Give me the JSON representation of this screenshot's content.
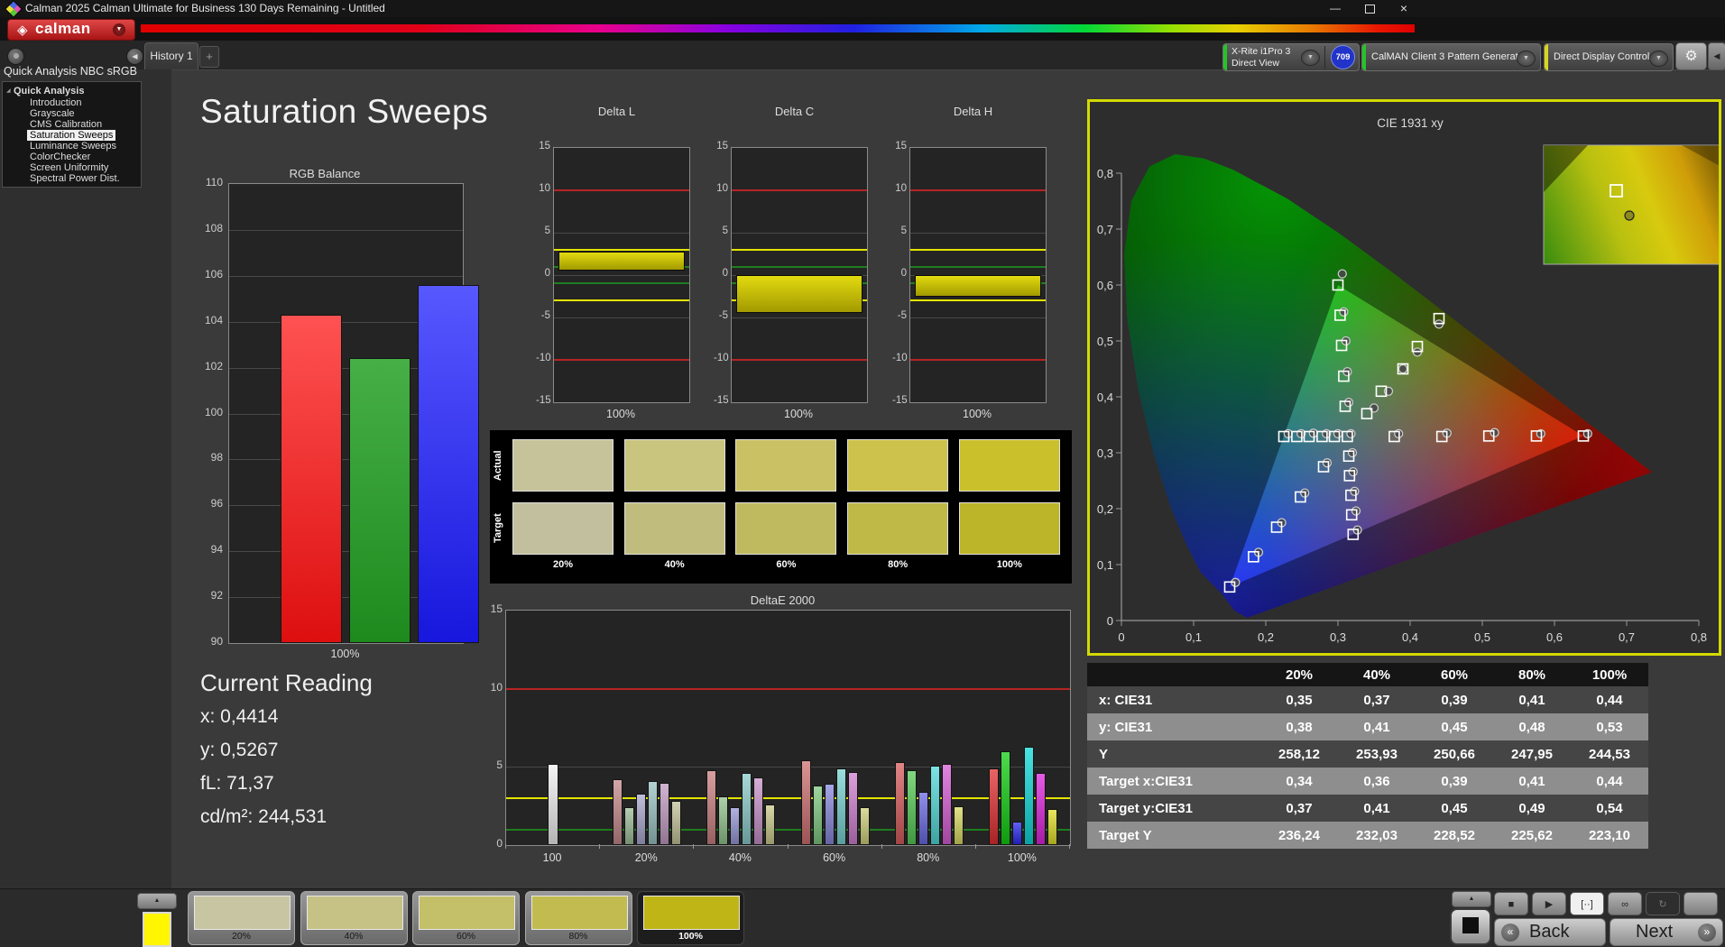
{
  "window": {
    "title": "Calman 2025 Calman Ultimate for Business 130 Days Remaining  - Untitled"
  },
  "icons": {
    "chevron_down": "▼",
    "chevron_left": "◀",
    "gear": "⚙",
    "add_tab": "+",
    "minimize": "—",
    "close": "×",
    "up": "▲",
    "stop": "■",
    "play": "▶",
    "measure": "[··]",
    "loop": "∞",
    "refresh": "↻",
    "back_chev": "«",
    "next_chev": "»",
    "tree_expanded": "◢",
    "logo_diamond": "◈",
    "dot": ""
  },
  "logo": {
    "text": "calman"
  },
  "tabs": {
    "history": "History 1"
  },
  "meters": {
    "meter1_line1": "X-Rite i1Pro 3",
    "meter1_line2": "Direct View",
    "badge": "709",
    "meter1_stripe": "#27c427",
    "meter2": "CalMAN Client 3 Pattern Generator",
    "meter2_stripe": "#27c427",
    "meter3": "Direct Display Control",
    "meter3_stripe": "#d6d621"
  },
  "sidebar": {
    "workflow_title": "Quick Analysis NBC sRGB",
    "root": "Quick Analysis",
    "items": [
      "Introduction",
      "Grayscale",
      "CMS Calibration",
      "Saturation Sweeps",
      "Luminance Sweeps",
      "ColorChecker",
      "Screen Uniformity",
      "Spectral Power Dist."
    ],
    "selected_index": 3
  },
  "page_title": "Saturation Sweeps",
  "current_reading": {
    "heading": "Current Reading",
    "lines": [
      "x: 0,4414",
      "y: 0,5267",
      "fL: 71,37",
      "cd/m²: 244,531"
    ]
  },
  "chart_data": [
    {
      "id": "rgb_balance",
      "type": "bar",
      "title": "RGB Balance",
      "category": "100%",
      "ylim": [
        90,
        110
      ],
      "ytick_step": 2,
      "series": [
        {
          "name": "red",
          "value": 104.3,
          "color_top": "#ff5252",
          "color_bottom": "#dd0f0f"
        },
        {
          "name": "green",
          "value": 102.4,
          "color_top": "#46b046",
          "color_bottom": "#1e8a1e"
        },
        {
          "name": "blue",
          "value": 105.6,
          "color_top": "#5858ff",
          "color_bottom": "#1717dd"
        }
      ]
    },
    {
      "id": "delta_l",
      "type": "bar",
      "title": "Delta L",
      "category": "100%",
      "ylim": [
        -15,
        15
      ],
      "yticks": [
        15,
        10,
        5,
        0,
        -5,
        -10,
        -15
      ],
      "limit_red": 10,
      "limit_yellow": 3,
      "limit_green": 1,
      "bar_from": 0.5,
      "bar_to": 2.8
    },
    {
      "id": "delta_c",
      "type": "bar",
      "title": "Delta C",
      "category": "100%",
      "ylim": [
        -15,
        15
      ],
      "yticks": [
        15,
        10,
        5,
        0,
        -5,
        -10,
        -15
      ],
      "limit_red": 10,
      "limit_yellow": 3,
      "limit_green": 1,
      "bar_from": -4.5,
      "bar_to": 0
    },
    {
      "id": "delta_h",
      "type": "bar",
      "title": "Delta H",
      "category": "100%",
      "ylim": [
        -15,
        15
      ],
      "yticks": [
        15,
        10,
        5,
        0,
        -5,
        -10,
        -15
      ],
      "limit_red": 10,
      "limit_yellow": 3,
      "limit_green": 1,
      "bar_from": -2.5,
      "bar_to": 0
    },
    {
      "id": "deltae2000",
      "type": "grouped_bar",
      "title": "DeltaE 2000",
      "ylim": [
        0,
        15
      ],
      "yticks": [
        0,
        5,
        10,
        15
      ],
      "limit_red": 10,
      "limit_yellow": 3,
      "limit_green": 1,
      "groups": [
        {
          "label": "100",
          "values": [
            5.2
          ],
          "colors": [
            "#f0f0f0"
          ]
        },
        {
          "label": "20%",
          "values": [
            4.2,
            2.4,
            3.3,
            4.1,
            4.0,
            2.8
          ],
          "colors": [
            "#c4898b",
            "#9dbd97",
            "#a8a8cf",
            "#99c2c2",
            "#c29bc2",
            "#c3c39a"
          ]
        },
        {
          "label": "40%",
          "values": [
            4.8,
            3.1,
            2.4,
            4.6,
            4.3,
            2.6
          ],
          "colors": [
            "#c97f7f",
            "#92c28c",
            "#9797d6",
            "#8ccaca",
            "#c791c7",
            "#c9c98c"
          ]
        },
        {
          "label": "60%",
          "values": [
            5.4,
            3.8,
            3.9,
            4.9,
            4.7,
            2.4
          ],
          "colors": [
            "#cf7070",
            "#7fc87f",
            "#8787dd",
            "#78d2d2",
            "#cf80cf",
            "#cfcf7b"
          ]
        },
        {
          "label": "80%",
          "values": [
            5.3,
            4.8,
            3.4,
            5.1,
            5.2,
            2.5
          ],
          "colors": [
            "#d65c5c",
            "#55cc55",
            "#6a6ae5",
            "#52d8d8",
            "#d65cd6",
            "#d8d860"
          ]
        },
        {
          "label": "100%",
          "values": [
            4.9,
            6.0,
            1.5,
            6.3,
            4.6,
            2.3
          ],
          "colors": [
            "#e03030",
            "#12cf12",
            "#2a2af0",
            "#0fd8d8",
            "#de24de",
            "#dede2a"
          ]
        }
      ]
    },
    {
      "id": "cie",
      "type": "scatter",
      "title": "CIE 1931 xy",
      "xlim": [
        0,
        0.8
      ],
      "ylim": [
        0,
        0.8
      ],
      "xtick_labels": [
        "0",
        "0,1",
        "0,2",
        "0,3",
        "0,4",
        "0,5",
        "0,6",
        "0,7",
        "0,8"
      ],
      "ytick_labels": [
        "0",
        "0,1",
        "0,2",
        "0,3",
        "0,4",
        "0,5",
        "0,6",
        "0,7",
        "0,8"
      ],
      "targets": [
        [
          0.378,
          0.329
        ],
        [
          0.444,
          0.329
        ],
        [
          0.509,
          0.33
        ],
        [
          0.575,
          0.33
        ],
        [
          0.64,
          0.33
        ],
        [
          0.31,
          0.383
        ],
        [
          0.308,
          0.437
        ],
        [
          0.305,
          0.492
        ],
        [
          0.303,
          0.546
        ],
        [
          0.3,
          0.6
        ],
        [
          0.28,
          0.275
        ],
        [
          0.248,
          0.221
        ],
        [
          0.215,
          0.167
        ],
        [
          0.183,
          0.114
        ],
        [
          0.15,
          0.06
        ],
        [
          0.295,
          0.329
        ],
        [
          0.278,
          0.329
        ],
        [
          0.26,
          0.329
        ],
        [
          0.243,
          0.329
        ],
        [
          0.225,
          0.329
        ],
        [
          0.315,
          0.294
        ],
        [
          0.316,
          0.259
        ],
        [
          0.318,
          0.224
        ],
        [
          0.319,
          0.189
        ],
        [
          0.321,
          0.154
        ],
        [
          0.34,
          0.37
        ],
        [
          0.36,
          0.41
        ],
        [
          0.39,
          0.45
        ],
        [
          0.41,
          0.49
        ],
        [
          0.44,
          0.54
        ],
        [
          0.313,
          0.329
        ]
      ],
      "measurements": [
        [
          0.384,
          0.334
        ],
        [
          0.451,
          0.335
        ],
        [
          0.517,
          0.336
        ],
        [
          0.581,
          0.334
        ],
        [
          0.646,
          0.334
        ],
        [
          0.315,
          0.39
        ],
        [
          0.313,
          0.445
        ],
        [
          0.311,
          0.5
        ],
        [
          0.308,
          0.552
        ],
        [
          0.306,
          0.62
        ],
        [
          0.285,
          0.282
        ],
        [
          0.254,
          0.228
        ],
        [
          0.222,
          0.175
        ],
        [
          0.19,
          0.122
        ],
        [
          0.158,
          0.068
        ],
        [
          0.3,
          0.334
        ],
        [
          0.284,
          0.334
        ],
        [
          0.266,
          0.335
        ],
        [
          0.249,
          0.334
        ],
        [
          0.231,
          0.334
        ],
        [
          0.32,
          0.3
        ],
        [
          0.321,
          0.266
        ],
        [
          0.323,
          0.231
        ],
        [
          0.325,
          0.196
        ],
        [
          0.327,
          0.162
        ],
        [
          0.35,
          0.38
        ],
        [
          0.37,
          0.41
        ],
        [
          0.39,
          0.45
        ],
        [
          0.41,
          0.48
        ],
        [
          0.44,
          0.53
        ],
        [
          0.318,
          0.334
        ]
      ]
    }
  ],
  "swatch_matrix": {
    "row_labels": [
      "Actual",
      "Target"
    ],
    "col_labels": [
      "20%",
      "40%",
      "60%",
      "80%",
      "100%"
    ],
    "actual_colors": [
      "#c6c29a",
      "#c9c47e",
      "#cac165",
      "#ccc24c",
      "#c9c02b"
    ],
    "target_colors": [
      "#c2bf9e",
      "#c0bc7d",
      "#bfba60",
      "#bfb947",
      "#bcb429"
    ]
  },
  "table": {
    "col_headers": [
      "20%",
      "40%",
      "60%",
      "80%",
      "100%"
    ],
    "rows": [
      {
        "label": "x: CIE31",
        "values": [
          "0,35",
          "0,37",
          "0,39",
          "0,41",
          "0,44"
        ]
      },
      {
        "label": "y: CIE31",
        "values": [
          "0,38",
          "0,41",
          "0,45",
          "0,48",
          "0,53"
        ]
      },
      {
        "label": "Y",
        "values": [
          "258,12",
          "253,93",
          "250,66",
          "247,95",
          "244,53"
        ]
      },
      {
        "label": "Target x:CIE31",
        "values": [
          "0,34",
          "0,36",
          "0,39",
          "0,41",
          "0,44"
        ]
      },
      {
        "label": "Target y:CIE31",
        "values": [
          "0,37",
          "0,41",
          "0,45",
          "0,49",
          "0,54"
        ]
      },
      {
        "label": "Target Y",
        "values": [
          "236,24",
          "232,03",
          "228,52",
          "225,62",
          "223,10"
        ]
      }
    ]
  },
  "bottom": {
    "mini_swatch_color": "#fff600",
    "patterns": [
      {
        "label": "20%",
        "color": "#c8c6a2"
      },
      {
        "label": "40%",
        "color": "#c6c285"
      },
      {
        "label": "60%",
        "color": "#c4bf69"
      },
      {
        "label": "80%",
        "color": "#c2bc50"
      },
      {
        "label": "100%",
        "color": "#bfb516"
      }
    ],
    "selected_index": 4,
    "back": "Back",
    "next": "Next"
  }
}
